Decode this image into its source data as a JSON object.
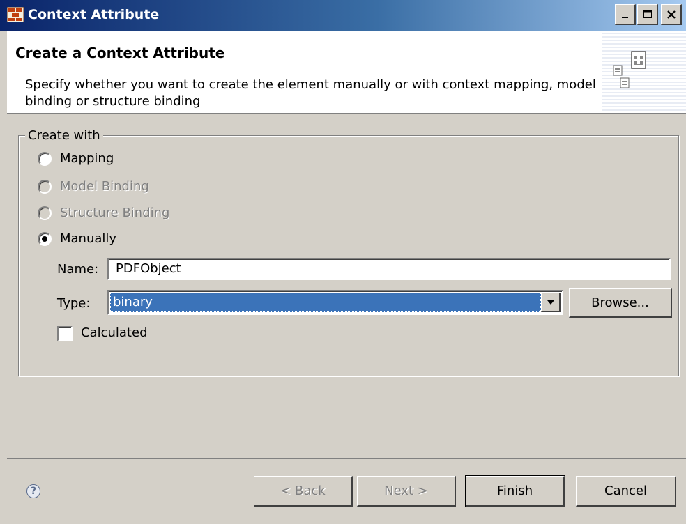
{
  "window": {
    "title": "Context Attribute",
    "controls": [
      "minimize-icon",
      "maximize-icon",
      "close-icon"
    ]
  },
  "header": {
    "title": "Create a Context Attribute",
    "description": "Specify whether you want to create the element manually or with context mapping, model binding or structure binding"
  },
  "group": {
    "legend": "Create with",
    "options": [
      {
        "label": "Mapping",
        "enabled": true,
        "selected": false
      },
      {
        "label": "Model Binding",
        "enabled": false,
        "selected": false
      },
      {
        "label": "Structure Binding",
        "enabled": false,
        "selected": false
      },
      {
        "label": "Manually",
        "enabled": true,
        "selected": true
      }
    ],
    "name_label": "Name:",
    "name_value": "PDFObject",
    "type_label": "Type:",
    "type_value": "binary",
    "browse_label": "Browse...",
    "calculated_label": "Calculated",
    "calculated_checked": false
  },
  "footer": {
    "help_icon": "help-icon",
    "back_label": "< Back",
    "next_label": "Next >",
    "finish_label": "Finish",
    "cancel_label": "Cancel"
  },
  "colors": {
    "title_bar": "#0a246a",
    "selection": "#3b73b9",
    "dialog_bg": "#d4d0c8"
  }
}
